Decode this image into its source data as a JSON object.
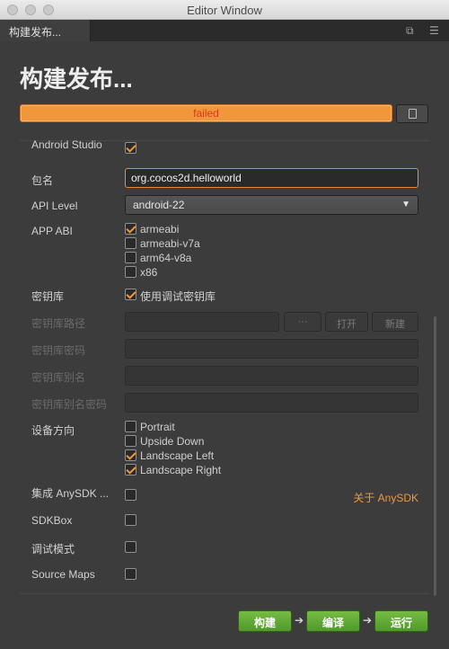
{
  "window": {
    "title": "Editor Window"
  },
  "tab": {
    "label": "构建发布..."
  },
  "heading": "构建发布...",
  "progress": {
    "text": "failed",
    "value": 1.0
  },
  "form": {
    "android_studio_label": "Android Studio",
    "package_label": "包名",
    "package_value": "org.cocos2d.helloworld",
    "api_label": "API Level",
    "api_value": "android-22",
    "abi_label": "APP ABI",
    "abi_options": [
      "armeabi",
      "armeabi-v7a",
      "arm64-v8a",
      "x86"
    ],
    "keystore_label": "密钥库",
    "keystore_debug_label": "使用调试密钥库",
    "keystore_path_label": "密钥库路径",
    "keystore_password_label": "密钥库密码",
    "keystore_alias_label": "密钥库别名",
    "keystore_alias_password_label": "密钥库别名密码",
    "ellipsis_button": "···",
    "open_button": "打开",
    "new_button": "新建",
    "orientation_label": "设备方向",
    "orientations": [
      "Portrait",
      "Upside Down",
      "Landscape Left",
      "Landscape Right"
    ],
    "anysdk_label": "集成 AnySDK ...",
    "anysdk_link": "关于 AnySDK",
    "sdkbox_label": "SDKBox",
    "debug_label": "调试模式",
    "source_maps_label": "Source Maps"
  },
  "actions": {
    "build": "构建",
    "compile": "编译",
    "run": "运行"
  },
  "colors": {
    "accent": "#f0973b",
    "progress_fill": "#f0973b",
    "failed_text": "#d83a1e",
    "action_green": "#5aa535"
  }
}
